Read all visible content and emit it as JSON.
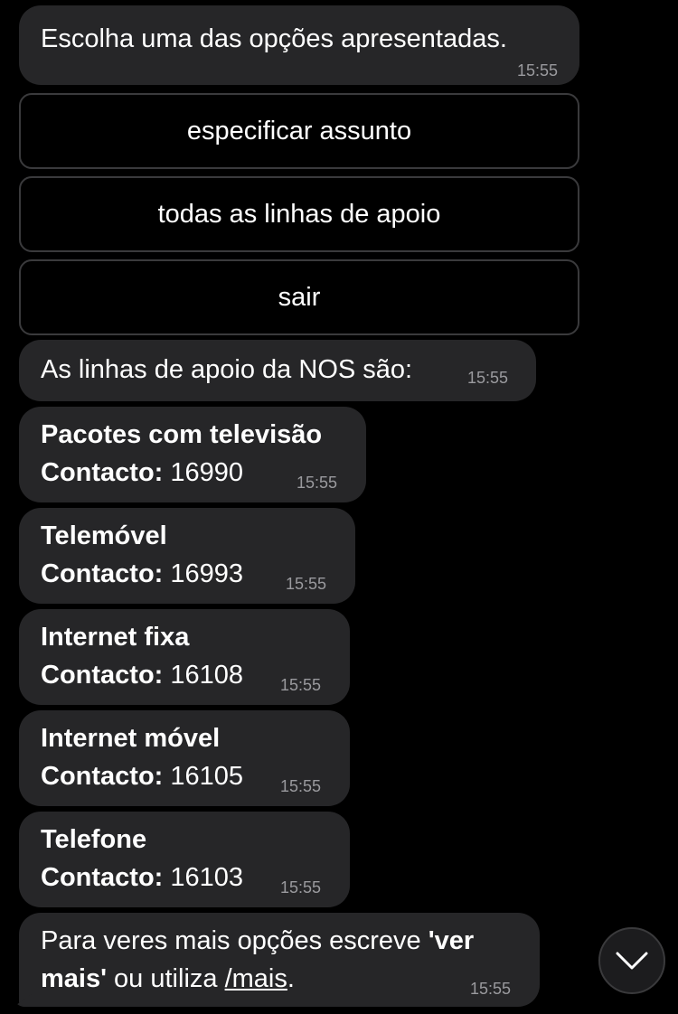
{
  "messages": {
    "intro": {
      "text": "Escolha uma das opções apresentadas.",
      "time": "15:55"
    },
    "lines_header": {
      "text": "As linhas de apoio da NOS são:",
      "time": "15:55"
    },
    "lines": [
      {
        "title": "Pacotes com televisão",
        "contact_label": "Contacto:",
        "number": "16990",
        "time": "15:55"
      },
      {
        "title": "Telemóvel",
        "contact_label": "Contacto:",
        "number": "16993",
        "time": "15:55"
      },
      {
        "title": "Internet fixa",
        "contact_label": "Contacto:",
        "number": "16108",
        "time": "15:55"
      },
      {
        "title": "Internet móvel",
        "contact_label": "Contacto:",
        "number": "16105",
        "time": "15:55"
      },
      {
        "title": "Telefone",
        "contact_label": "Contacto:",
        "number": "16103",
        "time": "15:55"
      }
    ],
    "more": {
      "part1": "Para veres mais opções escreve ",
      "bold1": "'ver",
      "bold2": "mais'",
      "part2": " ou utiliza ",
      "link": "/mais",
      "part3": ".",
      "time": "15:55"
    }
  },
  "buttons": {
    "specify": "especificar assunto",
    "all_lines": "todas as linhas de apoio",
    "exit": "sair"
  },
  "icons": {
    "scroll_down": "chevron-down-icon"
  },
  "colors": {
    "background": "#000000",
    "bubble": "#262628",
    "timestamp": "#9a9a9e",
    "button_border": "#3a3a3c"
  }
}
